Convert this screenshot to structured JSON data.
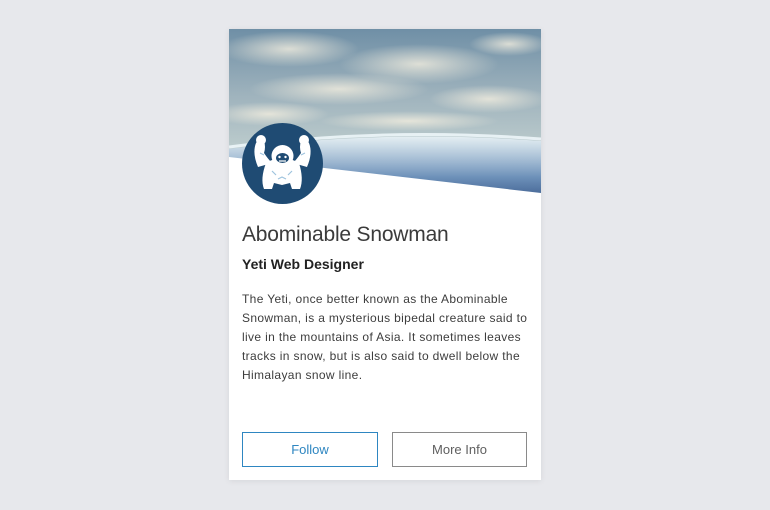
{
  "profile": {
    "name": "Abominable Snowman",
    "title": "Yeti Web Designer",
    "bio": "The Yeti, once better known as the Abominable Snowman, is a mysterious bipedal creature said to live in the mountains of Asia. It sometimes leaves tracks in snow, but is also said to dwell below the Himalayan snow line."
  },
  "actions": {
    "follow_label": "Follow",
    "more_info_label": "More Info"
  },
  "colors": {
    "accent": "#2e86c1",
    "avatar_bg": "#1f4b73",
    "page_bg": "#e7e8ec"
  },
  "icons": {
    "avatar": "yeti-avatar-icon"
  }
}
